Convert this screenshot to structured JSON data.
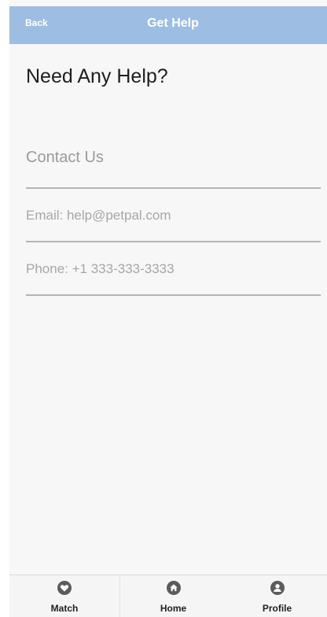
{
  "header": {
    "back_label": "Back",
    "title": "Get Help"
  },
  "main": {
    "heading": "Need Any Help?",
    "section_label": "Contact Us",
    "email": "Email: help@petpal.com",
    "phone": "Phone: +1 333-333-3333"
  },
  "tabbar": {
    "tabs": [
      {
        "label": "Match",
        "icon": "heart-icon"
      },
      {
        "label": "Home",
        "icon": "home-icon"
      },
      {
        "label": "Profile",
        "icon": "person-icon"
      }
    ]
  },
  "colors": {
    "header_bg": "#9dbde3",
    "page_bg": "#f7f7f7",
    "tab_icon_bg": "#5b5b5b"
  }
}
